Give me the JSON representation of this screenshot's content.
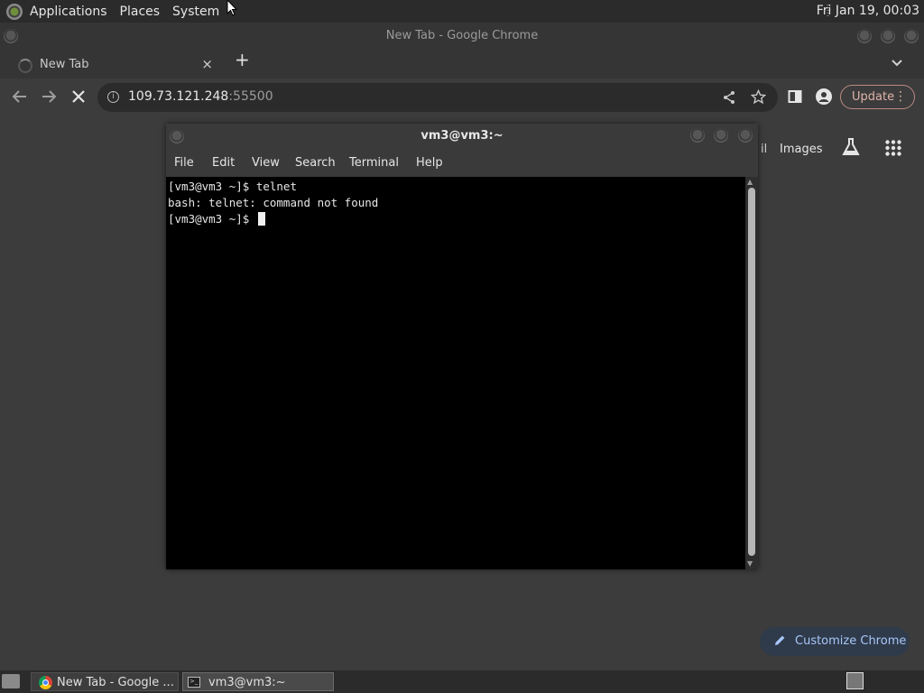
{
  "top_panel": {
    "menus": [
      "Applications",
      "Places",
      "System"
    ],
    "clock": "Fri Jan 19, 00:03"
  },
  "chrome": {
    "window_title": "New Tab - Google Chrome",
    "tab": {
      "title": "New Tab",
      "close": "×"
    },
    "new_tab": "+",
    "tab_search": "⌄",
    "omnibox": {
      "host": "109.73.121.248",
      "port": ":55500"
    },
    "update_label": "Update",
    "menu_dots": "⋮",
    "ntp": {
      "gmail_fragment": "il",
      "images_label": "Images",
      "customize_label": "Customize Chrome"
    }
  },
  "terminal": {
    "title": "vm3@vm3:~",
    "menus": [
      "File",
      "Edit",
      "View",
      "Search",
      "Terminal",
      "Help"
    ],
    "lines": [
      "[vm3@vm3 ~]$ telnet",
      "bash: telnet: command not found",
      "[vm3@vm3 ~]$ "
    ]
  },
  "taskbar": {
    "tasks": [
      {
        "label": "New Tab - Google ..."
      },
      {
        "label": "vm3@vm3:~"
      }
    ]
  },
  "colors": {
    "accent": "#a8c7fa",
    "update_outline": "#b98a84",
    "terminal_bg": "#000000"
  }
}
